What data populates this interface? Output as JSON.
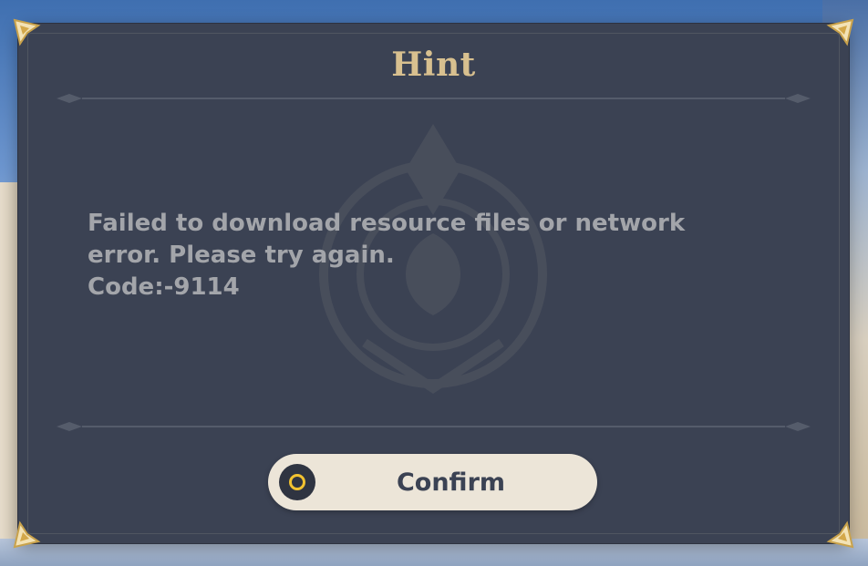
{
  "dialog": {
    "title": "Hint",
    "message_lines": [
      "Failed to download resource files or network",
      "error. Please try again.",
      "Code:-9114"
    ],
    "confirm_label": "Confirm",
    "confirm_icon": "circle-button-icon"
  },
  "colors": {
    "panel": "#3b4253",
    "title": "#d8c08f",
    "message": "#a3a5aa",
    "button_bg": "#ece5d8",
    "button_text": "#3b4253",
    "icon_ring": "#f2c230"
  }
}
